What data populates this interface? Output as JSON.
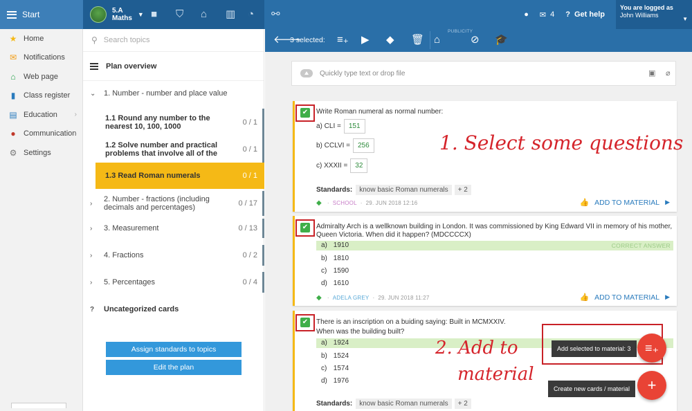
{
  "topbar": {
    "start_label": "Start",
    "class_name": "5.A",
    "class_subject": "Maths",
    "messages_count": "4",
    "help_label": "Get help",
    "logged_as_label": "You are logged as",
    "user_name": "John Williams"
  },
  "sidebar": {
    "items": [
      {
        "label": "Home",
        "icon": "star-icon"
      },
      {
        "label": "Notifications",
        "icon": "envelope-icon"
      },
      {
        "label": "Web page",
        "icon": "house-icon"
      },
      {
        "label": "Class register",
        "icon": "book-icon"
      },
      {
        "label": "Education",
        "icon": "education-book-icon"
      },
      {
        "label": "Communication",
        "icon": "chat-icon"
      },
      {
        "label": "Settings",
        "icon": "gear-icon"
      }
    ]
  },
  "topics": {
    "search_placeholder": "Search topics",
    "plan_title": "Plan overview",
    "items": [
      {
        "label": "1. Number - number and place value",
        "score": ""
      },
      {
        "label": "2. Number - fractions (including decimals and percentages)",
        "score": "0 / 17"
      },
      {
        "label": "3. Measurement",
        "score": "0 / 13"
      },
      {
        "label": "4. Fractions",
        "score": "0 / 2"
      },
      {
        "label": "5. Percentages",
        "score": "0 / 4"
      },
      {
        "label": "Uncategorized cards",
        "score": ""
      }
    ],
    "subitems": [
      {
        "label": "1.1 Round any number to the nearest 10, 100, 1000",
        "score": "0 / 1"
      },
      {
        "label": "1.2 Solve number and practical problems that involve all of the",
        "score": "0 / 1"
      },
      {
        "label": "1.3 Read Roman numerals",
        "score": "0 / 1"
      }
    ],
    "assign_button": "Assign standards to topics",
    "edit_button": "Edit the plan"
  },
  "actionbar": {
    "selected_label": "3 selected:",
    "publicity_label": "PUBLICITY"
  },
  "dropbox": {
    "placeholder": "Quickly type text or drop file"
  },
  "cards": [
    {
      "question": "Write Roman numeral as normal number:",
      "fills": [
        {
          "label": "a) CLI =",
          "value": "151"
        },
        {
          "label": "b) CCLVI =",
          "value": "256"
        },
        {
          "label": "c) XXXII =",
          "value": "32"
        }
      ],
      "standards_label": "Standards:",
      "standard": "know basic Roman numerals",
      "more": "+ 2",
      "author": "SCHOOL",
      "date": "29. JUN 2018 12:16",
      "add_label": "ADD TO MATERIAL"
    },
    {
      "question": "Admiralty Arch is a wellknown building in London. It was commissioned by King Edward VII in memory of his mother, Queen Victoria. When did it happen? (MDCCCCX)",
      "options": [
        {
          "letter": "a)",
          "text": "1910",
          "correct": true
        },
        {
          "letter": "b)",
          "text": "1810",
          "correct": false
        },
        {
          "letter": "c)",
          "text": "1590",
          "correct": false
        },
        {
          "letter": "d)",
          "text": "1610",
          "correct": false
        }
      ],
      "correct_label": "CORRECT ANSWER",
      "author": "ADELA GREY",
      "date": "29. JUN 2018 11:27",
      "add_label": "ADD TO MATERIAL"
    },
    {
      "question_line1": "There is an inscription on a buiding saying: Built in MCMXXIV.",
      "question_line2": "When was the building built?",
      "options": [
        {
          "letter": "a)",
          "text": "1924",
          "correct": true
        },
        {
          "letter": "b)",
          "text": "1524",
          "correct": false
        },
        {
          "letter": "c)",
          "text": "1574",
          "correct": false
        },
        {
          "letter": "d)",
          "text": "1976",
          "correct": false
        }
      ],
      "standards_label": "Standards:",
      "standard": "know basic Roman numerals",
      "more": "+ 2"
    }
  ],
  "annotations": {
    "step1": "1. Select some questions",
    "step2_line1": "2. Add to",
    "step2_line2": "material"
  },
  "fab": {
    "add_selected_tip": "Add selected to material: 3",
    "create_tip": "Create new cards / material"
  },
  "colors": {
    "topbar": "#2a6fa8",
    "accent_yellow": "#f5b916",
    "button_blue": "#3398db",
    "checkbox_green": "#3fae49",
    "fab_red": "#e94335",
    "annotation_red": "#d5242b"
  }
}
